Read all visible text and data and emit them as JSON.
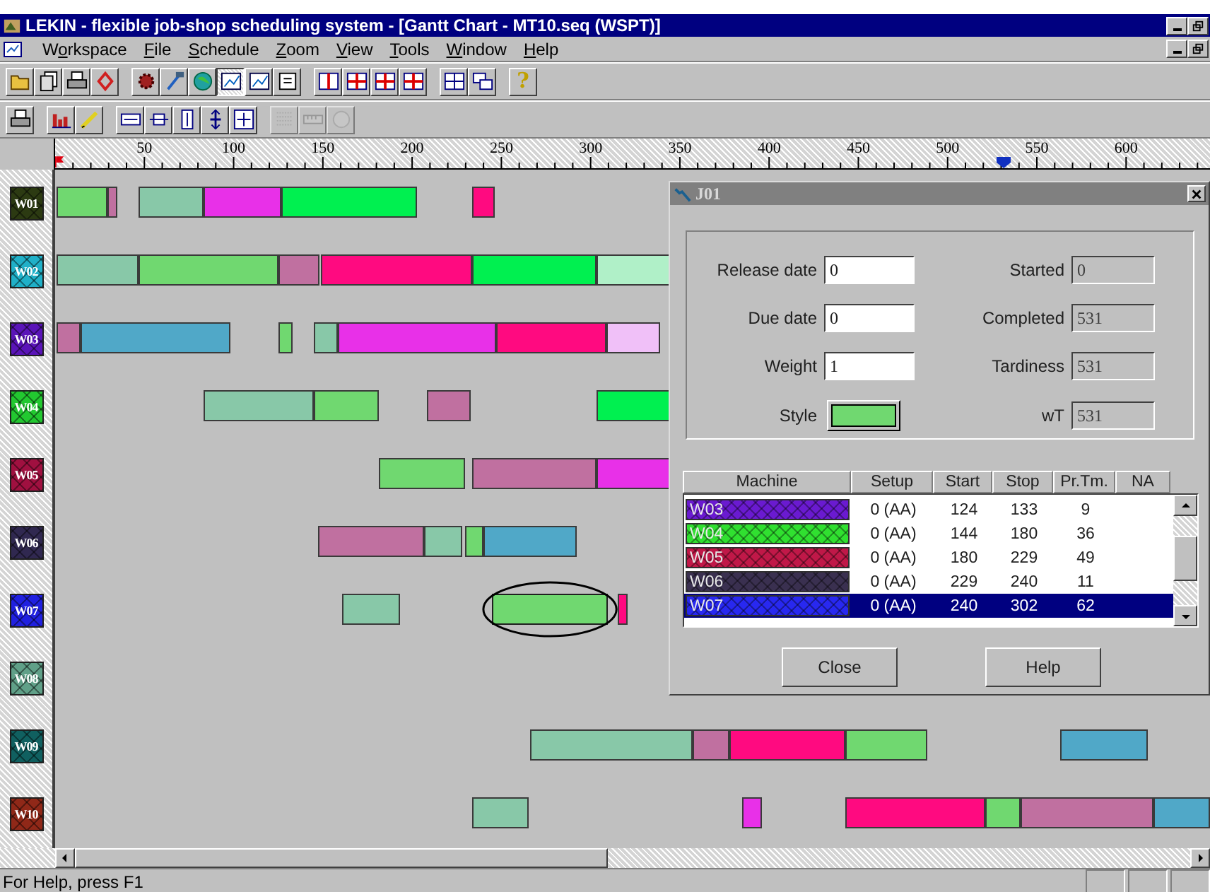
{
  "window": {
    "title": "LEKIN - flexible job-shop scheduling system - [Gantt Chart - MT10.seq (WSPT)]"
  },
  "menu": [
    {
      "pre": "W",
      "key": "o",
      "post": "rkspace"
    },
    {
      "key": "F",
      "post": "ile"
    },
    {
      "key": "S",
      "post": "chedule"
    },
    {
      "key": "Z",
      "post": "oom"
    },
    {
      "key": "V",
      "post": "iew"
    },
    {
      "key": "T",
      "post": "ools"
    },
    {
      "key": "W",
      "post": "indow"
    },
    {
      "key": "H",
      "post": "elp"
    }
  ],
  "toolbar_1": [
    [
      {
        "pressed": false
      },
      {
        "pressed": false
      },
      {
        "pressed": false
      },
      {
        "pressed": false
      }
    ],
    [
      {
        "pressed": false
      },
      {
        "pressed": false
      },
      {
        "pressed": false
      },
      {
        "pressed": true
      },
      {
        "pressed": false
      },
      {
        "pressed": false
      }
    ],
    [
      {
        "pressed": false
      },
      {
        "pressed": false
      },
      {
        "pressed": false
      },
      {
        "pressed": false
      }
    ],
    [
      {
        "pressed": false
      },
      {
        "pressed": false
      }
    ],
    [
      {
        "pressed": false,
        "glyph": "?"
      }
    ]
  ],
  "toolbar_2": [
    [
      {
        "disabled": false
      }
    ],
    [
      {
        "disabled": false
      },
      {
        "disabled": false
      }
    ],
    [
      {
        "disabled": false
      },
      {
        "disabled": false
      },
      {
        "disabled": false
      },
      {
        "disabled": false
      },
      {
        "disabled": false
      }
    ],
    [
      {
        "disabled": true
      },
      {
        "disabled": true
      },
      {
        "disabled": true
      }
    ]
  ],
  "gantt": {
    "ruler_labels": [
      "50",
      "100",
      "150",
      "200",
      "250",
      "300",
      "350",
      "400",
      "450",
      "500",
      "550",
      "600"
    ],
    "rows": [
      {
        "label": "W01",
        "color": "#2c3a12",
        "bars": [
          {
            "color": "#70d870",
            "selected": false
          },
          {
            "color": "#c070a0",
            "selected": false
          },
          {
            "color": "#88c8a8",
            "selected": false
          },
          {
            "color": "#e830e8",
            "selected": false
          },
          {
            "color": "#00f050",
            "selected": false
          },
          {
            "color": "#ff0a80",
            "selected": false
          }
        ]
      },
      {
        "label": "W02",
        "color": "#20b0c8",
        "bars": [
          {
            "color": "#88c8a8",
            "selected": false
          },
          {
            "color": "#70d870",
            "selected": false
          },
          {
            "color": "#c070a0",
            "selected": false
          },
          {
            "color": "#ff0a80",
            "selected": false
          },
          {
            "color": "#00f050",
            "selected": false
          },
          {
            "color": "#b0f0c8",
            "selected": false
          }
        ]
      },
      {
        "label": "W03",
        "color": "#5a14b8",
        "bars": [
          {
            "color": "#c070a0",
            "selected": false
          },
          {
            "color": "#50a8c8",
            "selected": false
          },
          {
            "color": "#70d870",
            "selected": false
          },
          {
            "color": "#88c8a8",
            "selected": false
          },
          {
            "color": "#e830e8",
            "selected": false
          },
          {
            "color": "#ff0a80",
            "selected": false
          },
          {
            "color": "#f0c0f8",
            "selected": false
          }
        ]
      },
      {
        "label": "W04",
        "color": "#22c830",
        "bars": [
          {
            "color": "#88c8a8",
            "selected": false
          },
          {
            "color": "#70d870",
            "selected": false
          },
          {
            "color": "#c070a0",
            "selected": false
          },
          {
            "color": "#00f050",
            "selected": false
          }
        ]
      },
      {
        "label": "W05",
        "color": "#a01040",
        "bars": [
          {
            "color": "#70d870",
            "selected": false
          },
          {
            "color": "#c070a0",
            "selected": false
          },
          {
            "color": "#e830e8",
            "selected": false
          }
        ]
      },
      {
        "label": "W06",
        "color": "#302850",
        "bars": [
          {
            "color": "#c070a0",
            "selected": false
          },
          {
            "color": "#88c8a8",
            "selected": false
          },
          {
            "color": "#70d870",
            "selected": false
          },
          {
            "color": "#50a8c8",
            "selected": false
          }
        ]
      },
      {
        "label": "W07",
        "color": "#2020e0",
        "bars": [
          {
            "color": "#88c8a8",
            "selected": false
          },
          {
            "color": "#70d870",
            "selected": true
          },
          {
            "color": "#ff0a80",
            "selected": false
          }
        ]
      },
      {
        "label": "W08",
        "color": "#60a088"
      },
      {
        "label": "W09",
        "color": "#106060",
        "bars": [
          {
            "color": "#88c8a8",
            "selected": false
          },
          {
            "color": "#c070a0",
            "selected": false
          },
          {
            "color": "#ff0a80",
            "selected": false
          },
          {
            "color": "#70d870",
            "selected": false
          },
          {
            "color": "#50a8c8",
            "selected": false
          }
        ]
      },
      {
        "label": "W10",
        "color": "#902818",
        "bars": [
          {
            "color": "#88c8a8",
            "selected": false
          },
          {
            "color": "#e830e8",
            "selected": false
          },
          {
            "color": "#ff0a80",
            "selected": false
          },
          {
            "color": "#70d870",
            "selected": false
          },
          {
            "color": "#c070a0",
            "selected": false
          },
          {
            "color": "#50a8c8",
            "selected": false
          }
        ]
      }
    ]
  },
  "dialog": {
    "title": "J01",
    "fields": [
      {
        "label": "Release date",
        "value": "0",
        "readonly": false
      },
      {
        "label": "Started",
        "value": "0",
        "readonly": true
      },
      {
        "label": "Due date",
        "value": "0",
        "readonly": false
      },
      {
        "label": "Completed",
        "value": "531",
        "readonly": true
      },
      {
        "label": "Weight",
        "value": "1",
        "readonly": false
      },
      {
        "label": "Tardiness",
        "value": "531",
        "readonly": true
      }
    ],
    "style": {
      "label": "Style",
      "color": "#70d870"
    },
    "wt": {
      "label": "wT",
      "value": "531",
      "readonly": true
    },
    "table": {
      "columns": [
        "Machine",
        "Setup",
        "Start",
        "Stop",
        "Pr.Tm.",
        "NA"
      ],
      "rows": [
        {
          "machine": "W03",
          "color": "#6a1ad0",
          "setup": "0 (AA)",
          "start": "124",
          "stop": "133",
          "prtm": "9",
          "selected": false
        },
        {
          "machine": "W04",
          "color": "#30e030",
          "setup": "0 (AA)",
          "start": "144",
          "stop": "180",
          "prtm": "36",
          "selected": false
        },
        {
          "machine": "W05",
          "color": "#c01848",
          "setup": "0 (AA)",
          "start": "180",
          "stop": "229",
          "prtm": "49",
          "selected": false
        },
        {
          "machine": "W06",
          "color": "#3a3050",
          "setup": "0 (AA)",
          "start": "229",
          "stop": "240",
          "prtm": "11",
          "selected": false
        },
        {
          "machine": "W07",
          "color": "#2828f0",
          "setup": "0 (AA)",
          "start": "240",
          "stop": "302",
          "prtm": "62",
          "selected": true
        }
      ]
    },
    "buttons": [
      "Close",
      "Help"
    ]
  },
  "status_bar": {
    "text": "For Help, press F1"
  }
}
